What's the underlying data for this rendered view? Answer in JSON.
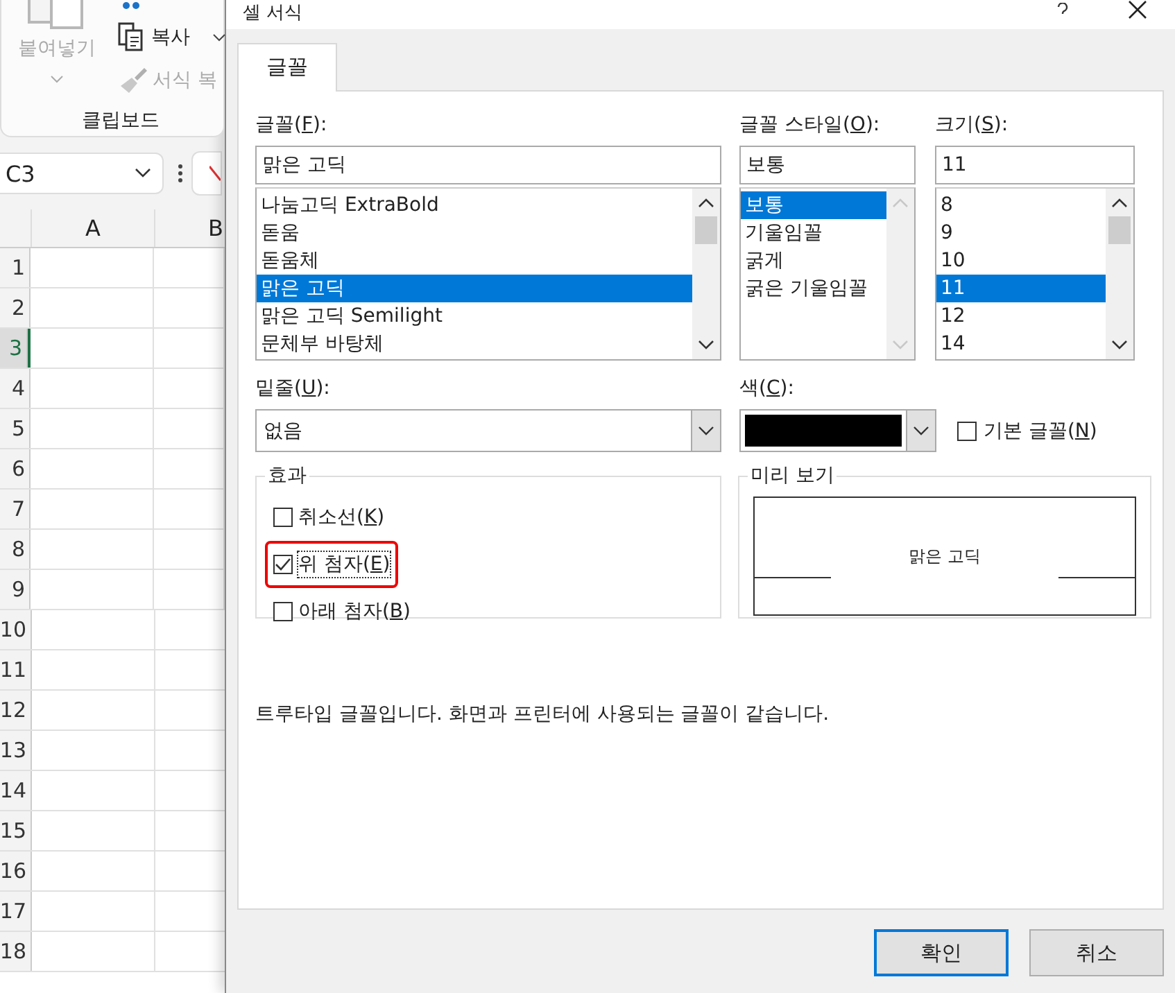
{
  "excel": {
    "ribbon": {
      "paste_label": "붙여넣기",
      "copy_label": "복사",
      "format_painter_label": "서식 복",
      "group_label": "클립보드"
    },
    "name_box": "C3",
    "columns": [
      "A",
      "B"
    ],
    "rows": [
      {
        "label": "1",
        "selected": false
      },
      {
        "label": "2",
        "selected": false
      },
      {
        "label": "3",
        "selected": true
      },
      {
        "label": "4",
        "selected": false
      },
      {
        "label": "5",
        "selected": false
      },
      {
        "label": "6",
        "selected": false
      },
      {
        "label": "7",
        "selected": false
      },
      {
        "label": "8",
        "selected": false
      },
      {
        "label": "9",
        "selected": false
      },
      {
        "label": "10",
        "selected": false
      },
      {
        "label": "11",
        "selected": false
      },
      {
        "label": "12",
        "selected": false
      },
      {
        "label": "13",
        "selected": false
      },
      {
        "label": "14",
        "selected": false
      },
      {
        "label": "15",
        "selected": false
      },
      {
        "label": "16",
        "selected": false
      },
      {
        "label": "17",
        "selected": false
      },
      {
        "label": "18",
        "selected": false
      }
    ]
  },
  "dialog": {
    "title": "셀 서식",
    "tabs": [
      {
        "label": "글꼴",
        "selected": true
      }
    ],
    "font": {
      "label": {
        "before": "글꼴(",
        "key": "F",
        "after": "):"
      },
      "value": "맑은 고딕",
      "items": [
        {
          "label": "나눔고딕 ExtraBold",
          "selected": false
        },
        {
          "label": "돋움",
          "selected": false
        },
        {
          "label": "돋움체",
          "selected": false
        },
        {
          "label": "맑은 고딕",
          "selected": true
        },
        {
          "label": "맑은 고딕 Semilight",
          "selected": false
        },
        {
          "label": "문체부 바탕체",
          "selected": false
        }
      ]
    },
    "style": {
      "label": {
        "before": "글꼴 스타일(",
        "key": "O",
        "after": "):"
      },
      "value": "보통",
      "items": [
        {
          "label": "보통",
          "selected": true
        },
        {
          "label": "기울임꼴",
          "selected": false
        },
        {
          "label": "굵게",
          "selected": false
        },
        {
          "label": "굵은 기울임꼴",
          "selected": false
        }
      ]
    },
    "size": {
      "label": {
        "before": "크기(",
        "key": "S",
        "after": "):"
      },
      "value": "11",
      "items": [
        {
          "label": "8",
          "selected": false
        },
        {
          "label": "9",
          "selected": false
        },
        {
          "label": "10",
          "selected": false
        },
        {
          "label": "11",
          "selected": true
        },
        {
          "label": "12",
          "selected": false
        },
        {
          "label": "14",
          "selected": false
        }
      ]
    },
    "underline": {
      "label": {
        "before": "밑줄(",
        "key": "U",
        "after": "):"
      },
      "value": "없음"
    },
    "color": {
      "label": {
        "before": "색(",
        "key": "C",
        "after": "):"
      },
      "color": "#000000"
    },
    "normal_font": {
      "label": {
        "before": "기본 글꼴(",
        "key": "N",
        "after": ")"
      },
      "checked": false
    },
    "effects": {
      "title": "효과",
      "items": [
        {
          "label": {
            "before": "취소선(",
            "key": "K",
            "after": ")"
          },
          "checked": false,
          "highlighted": false
        },
        {
          "label": {
            "before": "위 첨자(",
            "key": "E",
            "after": ")"
          },
          "checked": true,
          "highlighted": true
        },
        {
          "label": {
            "before": "아래 첨자(",
            "key": "B",
            "after": ")"
          },
          "checked": false,
          "highlighted": false
        }
      ]
    },
    "preview": {
      "title": "미리 보기",
      "text": "맑은 고딕"
    },
    "note": "트루타입 글꼴입니다. 화면과 프린터에 사용되는 글꼴이 같습니다.",
    "buttons": [
      {
        "label": "확인",
        "default": true
      },
      {
        "label": "취소",
        "default": false
      }
    ]
  }
}
